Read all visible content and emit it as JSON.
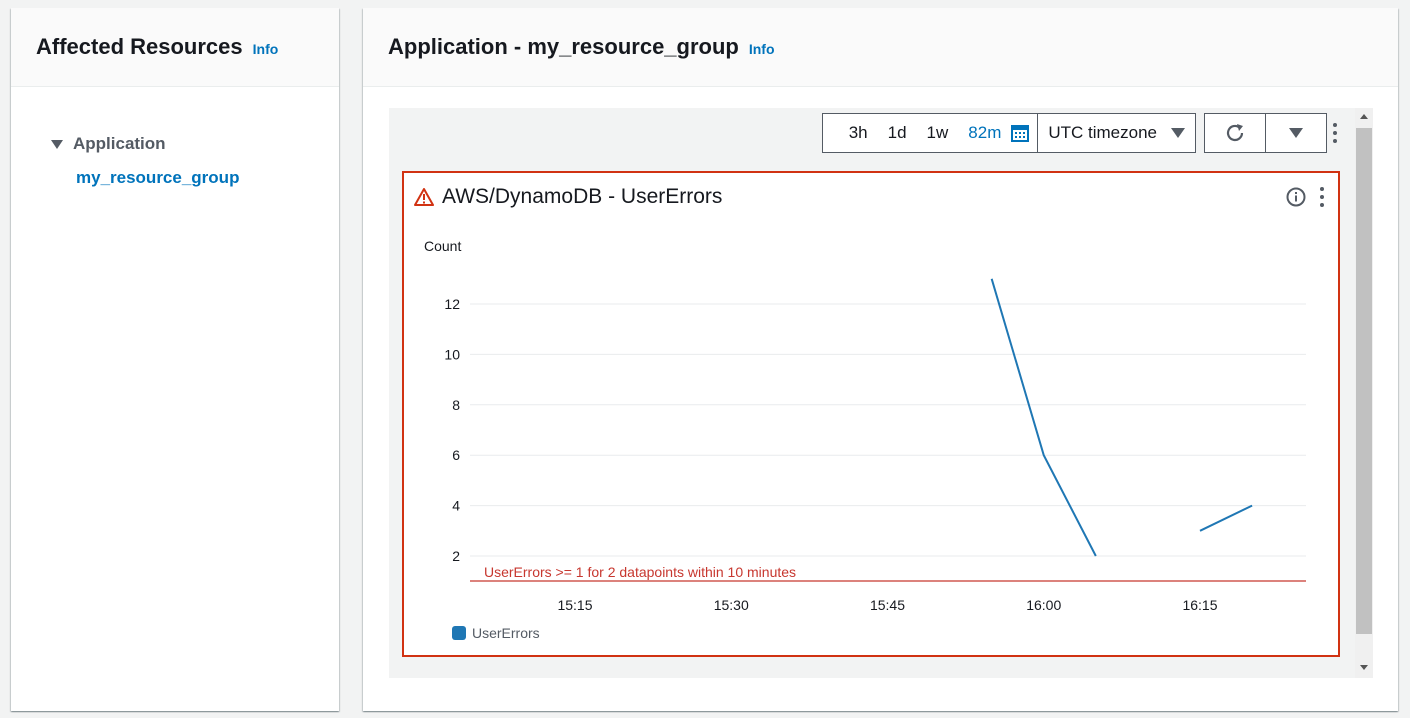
{
  "left_panel": {
    "title": "Affected Resources",
    "info": "Info",
    "tree": {
      "node_label": "Application",
      "child_label": "my_resource_group"
    }
  },
  "right_panel": {
    "title": "Application - my_resource_group",
    "info": "Info"
  },
  "toolbar": {
    "ranges": [
      "3h",
      "1d",
      "1w",
      "82m"
    ],
    "active_range": "82m",
    "timezone": "UTC timezone"
  },
  "widget": {
    "title": "AWS/DynamoDB - UserErrors",
    "status": "alarm"
  },
  "colors": {
    "accent": "#0073bb",
    "alarm": "#d13212",
    "series": "#1f77b4",
    "threshold": "#c7372f"
  },
  "chart_data": {
    "type": "line",
    "ylabel": "Count",
    "xlabel": "",
    "y_ticks": [
      2,
      4,
      6,
      8,
      10,
      12
    ],
    "x_ticks": [
      "15:15",
      "15:30",
      "15:45",
      "16:00",
      "16:15"
    ],
    "x_range_minutes": [
      "15:05",
      "16:25"
    ],
    "grid": true,
    "legend_position": "bottom-left",
    "series": [
      {
        "name": "UserErrors",
        "segments": [
          [
            {
              "x": "15:55",
              "y": 13
            },
            {
              "x": "16:00",
              "y": 6
            },
            {
              "x": "16:05",
              "y": 2
            }
          ],
          [
            {
              "x": "16:15",
              "y": 3
            },
            {
              "x": "16:20",
              "y": 4
            }
          ]
        ]
      }
    ],
    "annotations": [
      {
        "type": "threshold",
        "value": 1,
        "label": "UserErrors >= 1 for 2 datapoints within 10 minutes"
      }
    ]
  }
}
